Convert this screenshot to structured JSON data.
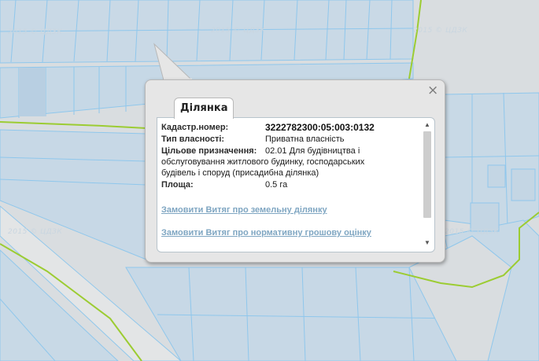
{
  "watermark": "2015 © ЦДЗК",
  "popup": {
    "tab_label": "Ділянка",
    "close_icon": "close-icon",
    "fields": {
      "cadastre_label": "Кадастр.номер:",
      "cadastre_value": "3222782300:05:003:0132",
      "ownership_label": "Тип власності:",
      "ownership_value": "Приватна власність",
      "purpose_label": "Цільове призначення:",
      "purpose_value_1": "02.01 Для будівництва і",
      "purpose_value_2": "обслуговування житлового будинку, господарських",
      "purpose_value_3": "будівель і споруд (присадибна ділянка)",
      "area_label": "Площа:",
      "area_value": "0.5 га"
    },
    "links": {
      "extract_land": "Замовити Витяг про земельну ділянку",
      "extract_valuation": "Замовити Витяг про нормативну грошову оцінку"
    }
  },
  "colors": {
    "parcel_fill": "#c8d9e6",
    "parcel_line": "#8fc7ec",
    "boundary": "#9ccc32",
    "road": "#e4e4e4"
  }
}
